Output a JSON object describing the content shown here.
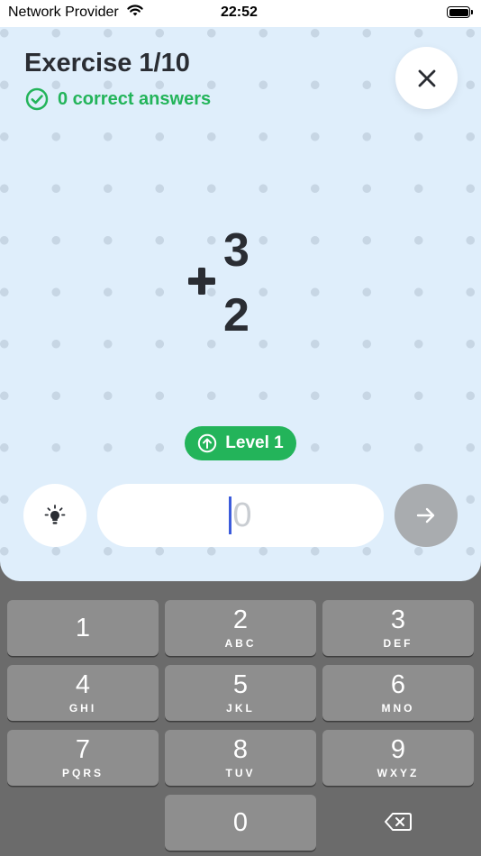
{
  "status_bar": {
    "carrier": "Network Provider",
    "time": "22:52"
  },
  "exercise": {
    "title": "Exercise 1/10",
    "correct_text": "0 correct answers",
    "operator": "+",
    "top_number": "3",
    "bottom_number": "2",
    "level_label": "Level 1"
  },
  "answer": {
    "placeholder": "0"
  },
  "colors": {
    "accent_green": "#23b45a",
    "text_dark": "#2a2d33",
    "background": "#dfeefb",
    "next_button_disabled": "#a9acaf",
    "caret": "#3b5bdb"
  },
  "icons": {
    "close": "close-icon",
    "check": "check-circle-icon",
    "level": "arrow-up-circle-icon",
    "hint": "lightbulb-icon",
    "next": "arrow-right-icon",
    "backspace": "backspace-icon"
  },
  "keyboard": {
    "keys": [
      {
        "digit": "1",
        "letters": ""
      },
      {
        "digit": "2",
        "letters": "ABC"
      },
      {
        "digit": "3",
        "letters": "DEF"
      },
      {
        "digit": "4",
        "letters": "GHI"
      },
      {
        "digit": "5",
        "letters": "JKL"
      },
      {
        "digit": "6",
        "letters": "MNO"
      },
      {
        "digit": "7",
        "letters": "PQRS"
      },
      {
        "digit": "8",
        "letters": "TUV"
      },
      {
        "digit": "9",
        "letters": "WXYZ"
      },
      {
        "digit": "0",
        "letters": ""
      }
    ]
  }
}
